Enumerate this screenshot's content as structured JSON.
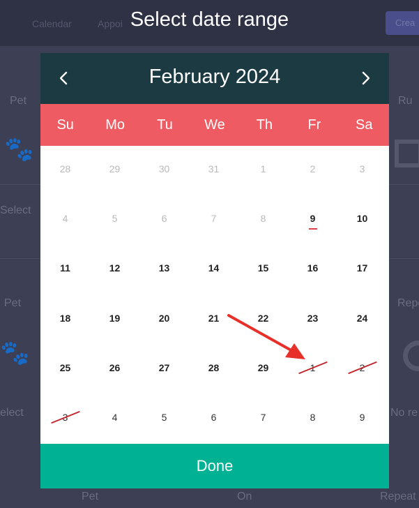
{
  "background": {
    "nav": [
      "Calendar",
      "Appoi"
    ],
    "create_button": "Crea",
    "labels": [
      "Pet",
      "Ru",
      "Select",
      "Pet",
      "Repe",
      "elect",
      "No re",
      "Pet",
      "On",
      "Repeat"
    ]
  },
  "title": "Select date range",
  "calendar": {
    "month_label": "February 2024",
    "weekdays": [
      "Su",
      "Mo",
      "Tu",
      "We",
      "Th",
      "Fr",
      "Sa"
    ],
    "weeks": [
      [
        {
          "d": "28",
          "s": "muted"
        },
        {
          "d": "29",
          "s": "muted"
        },
        {
          "d": "30",
          "s": "muted"
        },
        {
          "d": "31",
          "s": "muted"
        },
        {
          "d": "1",
          "s": "muted"
        },
        {
          "d": "2",
          "s": "muted"
        },
        {
          "d": "3",
          "s": "muted"
        }
      ],
      [
        {
          "d": "4",
          "s": "muted"
        },
        {
          "d": "5",
          "s": "muted"
        },
        {
          "d": "6",
          "s": "muted"
        },
        {
          "d": "7",
          "s": "muted"
        },
        {
          "d": "8",
          "s": "muted"
        },
        {
          "d": "9",
          "s": "bold",
          "today": true
        },
        {
          "d": "10",
          "s": "bold"
        }
      ],
      [
        {
          "d": "11",
          "s": "bold"
        },
        {
          "d": "12",
          "s": "bold"
        },
        {
          "d": "13",
          "s": "bold"
        },
        {
          "d": "14",
          "s": "bold"
        },
        {
          "d": "15",
          "s": "bold"
        },
        {
          "d": "16",
          "s": "bold"
        },
        {
          "d": "17",
          "s": "bold"
        }
      ],
      [
        {
          "d": "18",
          "s": "bold"
        },
        {
          "d": "19",
          "s": "bold"
        },
        {
          "d": "20",
          "s": "bold"
        },
        {
          "d": "21",
          "s": "bold"
        },
        {
          "d": "22",
          "s": "bold"
        },
        {
          "d": "23",
          "s": "bold"
        },
        {
          "d": "24",
          "s": "bold"
        }
      ],
      [
        {
          "d": "25",
          "s": "bold"
        },
        {
          "d": "26",
          "s": "bold"
        },
        {
          "d": "27",
          "s": "bold"
        },
        {
          "d": "28",
          "s": "bold"
        },
        {
          "d": "29",
          "s": "bold"
        },
        {
          "d": "1",
          "s": "normal",
          "strike": true
        },
        {
          "d": "2",
          "s": "normal",
          "strike": true
        }
      ],
      [
        {
          "d": "3",
          "s": "normal",
          "strike": true
        },
        {
          "d": "4",
          "s": "normal"
        },
        {
          "d": "5",
          "s": "normal"
        },
        {
          "d": "6",
          "s": "normal"
        },
        {
          "d": "7",
          "s": "normal"
        },
        {
          "d": "8",
          "s": "normal"
        },
        {
          "d": "9",
          "s": "normal"
        }
      ]
    ]
  },
  "done_label": "Done",
  "colors": {
    "header": "#1c3a42",
    "weekday_bar": "#ef5b62",
    "done": "#00b293",
    "annotation": "#e8302a"
  }
}
